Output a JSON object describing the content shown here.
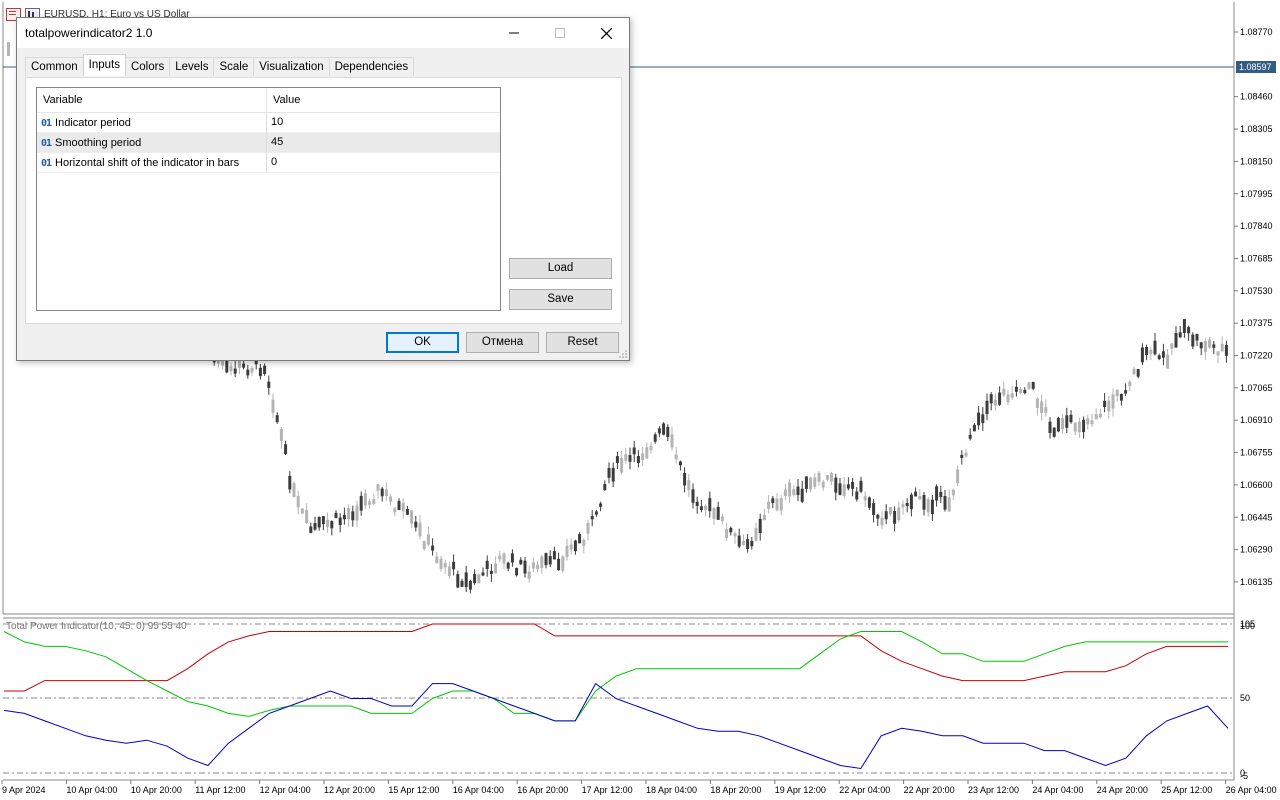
{
  "window": {
    "chart_title": "EURUSD, H1:  Euro vs US Dollar",
    "indicator_label": "Total Power Indicator(10, 45, 0) 95 55 40"
  },
  "price_axis": {
    "ticks": [
      "1.08770",
      "1.08597",
      "1.08460",
      "1.08305",
      "1.08150",
      "1.07995",
      "1.07840",
      "1.07685",
      "1.07530",
      "1.07375",
      "1.07220",
      "1.07065",
      "1.06910",
      "1.06755",
      "1.06600",
      "1.06445",
      "1.06290",
      "1.06135"
    ],
    "current_price": "1.08597",
    "current_price_color": "#345d86"
  },
  "sub_axis": {
    "ticks": [
      "105",
      "100",
      "50",
      "0",
      "-5"
    ]
  },
  "time_axis": {
    "labels": [
      "9 Apr 2024",
      "10 Apr 04:00",
      "10 Apr 20:00",
      "11 Apr 12:00",
      "12 Apr 04:00",
      "12 Apr 20:00",
      "15 Apr 12:00",
      "16 Apr 04:00",
      "16 Apr 20:00",
      "17 Apr 12:00",
      "18 Apr 04:00",
      "18 Apr 20:00",
      "19 Apr 12:00",
      "22 Apr 04:00",
      "22 Apr 20:00",
      "23 Apr 12:00",
      "24 Apr 04:00",
      "24 Apr 20:00",
      "25 Apr 12:00",
      "26 Apr 04:00"
    ]
  },
  "colors": {
    "bull_candle": "#b4b4b4",
    "bear_candle": "#3c3c3c",
    "series_red": "#c80000",
    "series_green": "#00c800",
    "series_blue": "#0000c8",
    "ok_border": "#0078d7"
  },
  "dialog": {
    "title": "totalpowerindicator2 1.0",
    "tabs": [
      {
        "label": "Common"
      },
      {
        "label": "Inputs",
        "active": true
      },
      {
        "label": "Colors"
      },
      {
        "label": "Levels"
      },
      {
        "label": "Scale"
      },
      {
        "label": "Visualization"
      },
      {
        "label": "Dependencies"
      }
    ],
    "table": {
      "headers": {
        "variable": "Variable",
        "value": "Value"
      },
      "rows": [
        {
          "type": "01",
          "variable": "Indicator period",
          "value": "10"
        },
        {
          "type": "01",
          "variable": "Smoothing period",
          "value": "45"
        },
        {
          "type": "01",
          "variable": "Horizontal shift of the indicator in bars",
          "value": "0"
        }
      ]
    },
    "buttons": {
      "load": "Load",
      "save": "Save",
      "ok": "OK",
      "cancel": "Отмена",
      "reset": "Reset"
    }
  },
  "chart_data": {
    "type": "line",
    "x": [
      0,
      1,
      2,
      3,
      4,
      5,
      6,
      7,
      8,
      9,
      10,
      11,
      12,
      13,
      14,
      15,
      16,
      17,
      18,
      19,
      20,
      21,
      22,
      23,
      24,
      25,
      26,
      27,
      28,
      29,
      30,
      31,
      32,
      33,
      34,
      35,
      36,
      37,
      38,
      39,
      40,
      41,
      42,
      43,
      44,
      45,
      46,
      47,
      48,
      49,
      50,
      51,
      52,
      53,
      54,
      55,
      56,
      57,
      58,
      59,
      60
    ],
    "series": [
      {
        "color": "#c80000",
        "values": [
          55,
          55,
          62,
          62,
          62,
          62,
          62,
          62,
          62,
          70,
          80,
          88,
          92,
          95,
          95,
          95,
          95,
          95,
          95,
          95,
          95,
          100,
          100,
          100,
          100,
          100,
          100,
          92,
          92,
          92,
          92,
          92,
          92,
          92,
          92,
          92,
          92,
          92,
          92,
          92,
          92,
          92,
          92,
          82,
          75,
          70,
          65,
          62,
          62,
          62,
          62,
          65,
          68,
          68,
          68,
          72,
          80,
          85,
          85,
          85,
          85
        ]
      },
      {
        "color": "#00c800",
        "values": [
          95,
          88,
          85,
          85,
          82,
          78,
          70,
          62,
          55,
          48,
          45,
          40,
          38,
          42,
          45,
          45,
          45,
          45,
          40,
          40,
          40,
          50,
          55,
          55,
          50,
          40,
          40,
          35,
          35,
          55,
          65,
          70,
          70,
          70,
          70,
          70,
          70,
          70,
          70,
          70,
          80,
          90,
          95,
          95,
          95,
          88,
          80,
          80,
          75,
          75,
          75,
          80,
          85,
          88,
          88,
          88,
          88,
          88,
          88,
          88,
          88
        ]
      },
      {
        "color": "#0000c8",
        "values": [
          42,
          40,
          35,
          30,
          25,
          22,
          20,
          22,
          18,
          10,
          5,
          20,
          30,
          40,
          45,
          50,
          55,
          50,
          50,
          45,
          45,
          60,
          60,
          55,
          50,
          45,
          40,
          35,
          35,
          60,
          50,
          45,
          40,
          35,
          30,
          28,
          28,
          25,
          20,
          15,
          10,
          5,
          3,
          25,
          30,
          28,
          25,
          25,
          20,
          20,
          20,
          15,
          15,
          10,
          5,
          10,
          25,
          35,
          40,
          45,
          30
        ]
      }
    ]
  }
}
